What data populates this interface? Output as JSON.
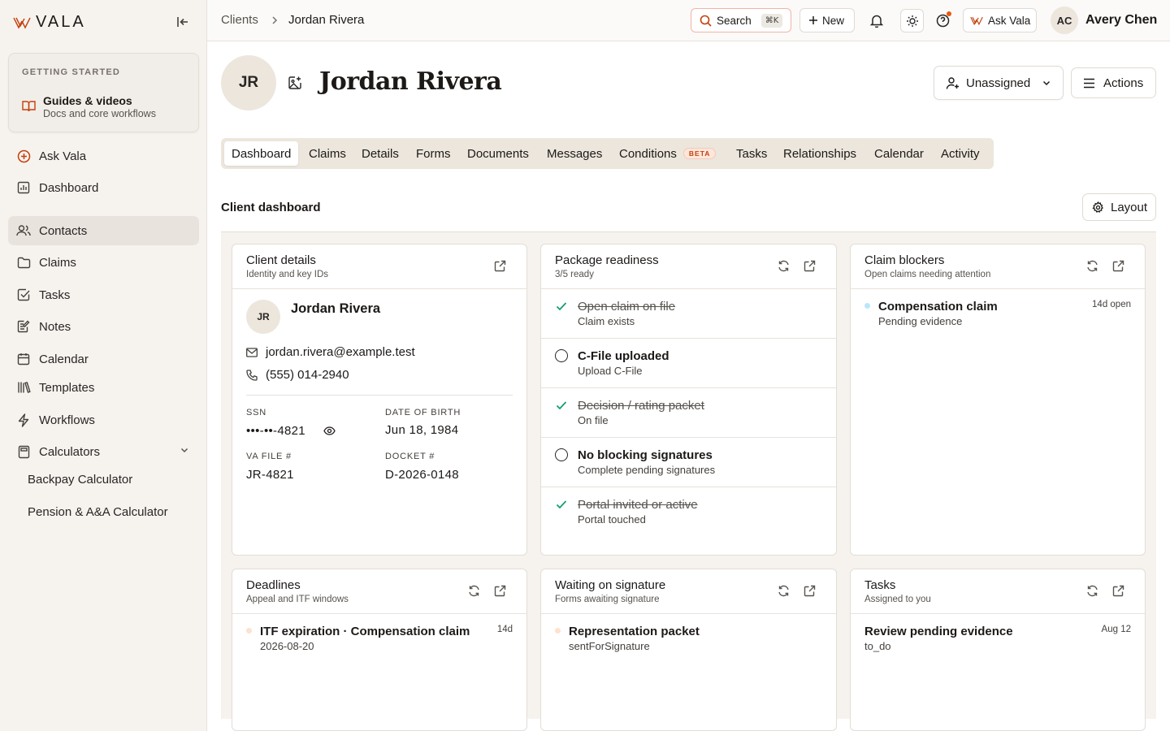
{
  "brand": {
    "name": "VALA",
    "accent": "#c2410c"
  },
  "sidebar": {
    "getting_started": {
      "label": "GETTING STARTED",
      "title": "Guides & videos",
      "subtitle": "Docs and core workflows"
    },
    "items": [
      {
        "label": "Ask Vala",
        "icon": "plus-circle-icon"
      },
      {
        "label": "Dashboard",
        "icon": "chart-icon"
      },
      {
        "label": "Contacts",
        "icon": "users-icon",
        "active": true
      },
      {
        "label": "Claims",
        "icon": "folder-icon"
      },
      {
        "label": "Tasks",
        "icon": "checkbox-icon"
      },
      {
        "label": "Notes",
        "icon": "notes-icon"
      },
      {
        "label": "Calendar",
        "icon": "calendar-icon"
      },
      {
        "label": "Templates",
        "icon": "library-icon"
      },
      {
        "label": "Workflows",
        "icon": "lightning-icon"
      },
      {
        "label": "Calculators",
        "icon": "calculator-icon"
      }
    ],
    "calculators": [
      "Backpay Calculator",
      "Pension & A&A Calculator"
    ]
  },
  "topbar": {
    "breadcrumb": [
      "Clients",
      "Jordan Rivera"
    ],
    "search_label": "Search",
    "search_shortcut": "⌘K",
    "new_label": "New",
    "ask_label": "Ask Vala",
    "user_initials": "AC",
    "user_name": "Avery Chen"
  },
  "client": {
    "initials": "JR",
    "name": "Jordan Rivera",
    "assignee": "Unassigned",
    "actions_label": "Actions"
  },
  "tabs": [
    {
      "label": "Dashboard",
      "active": true
    },
    {
      "label": "Claims"
    },
    {
      "label": "Details"
    },
    {
      "label": "Forms"
    },
    {
      "label": "Documents"
    },
    {
      "label": "Messages"
    },
    {
      "label": "Conditions",
      "badge": "BETA"
    },
    {
      "label": "Tasks"
    },
    {
      "label": "Relationships"
    },
    {
      "label": "Calendar"
    },
    {
      "label": "Activity"
    }
  ],
  "dashboard": {
    "title": "Client dashboard",
    "layout_label": "Layout",
    "client_details": {
      "title": "Client details",
      "subtitle": "Identity and key IDs",
      "initials": "JR",
      "name": "Jordan Rivera",
      "email": "jordan.rivera@example.test",
      "phone": "(555) 014-2940",
      "ssn_label": "SSN",
      "ssn": "•••-••-4821",
      "dob_label": "DATE OF BIRTH",
      "dob": "Jun 18, 1984",
      "va_file_label": "VA FILE #",
      "va_file": "JR-4821",
      "docket_label": "DOCKET #",
      "docket": "D-2026-0148"
    },
    "package_readiness": {
      "title": "Package readiness",
      "subtitle": "3/5 ready",
      "items": [
        {
          "title": "Open claim on file",
          "sub": "Claim exists",
          "done": true
        },
        {
          "title": "C-File uploaded",
          "sub": "Upload C-File",
          "done": false
        },
        {
          "title": "Decision / rating packet",
          "sub": "On file",
          "done": true
        },
        {
          "title": "No blocking signatures",
          "sub": "Complete pending signatures",
          "done": false
        },
        {
          "title": "Portal invited or active",
          "sub": "Portal touched",
          "done": true
        }
      ]
    },
    "claim_blockers": {
      "title": "Claim blockers",
      "subtitle": "Open claims needing attention",
      "items": [
        {
          "title": "Compensation claim",
          "sub": "Pending evidence",
          "meta": "14d open",
          "dot": "#bae6fd"
        }
      ]
    },
    "deadlines": {
      "title": "Deadlines",
      "subtitle": "Appeal and ITF windows",
      "items": [
        {
          "title": "ITF expiration · Compensation claim",
          "sub": "2026-08-20",
          "meta": "14d",
          "dot": "#fde2cf"
        }
      ]
    },
    "waiting_signature": {
      "title": "Waiting on signature",
      "subtitle": "Forms awaiting signature",
      "items": [
        {
          "title": "Representation packet",
          "sub": "sentForSignature",
          "dot": "#fde2cf"
        }
      ]
    },
    "tasks": {
      "title": "Tasks",
      "subtitle": "Assigned to you",
      "items": [
        {
          "title": "Review pending evidence",
          "sub": "to_do",
          "meta": "Aug 12"
        }
      ]
    }
  }
}
